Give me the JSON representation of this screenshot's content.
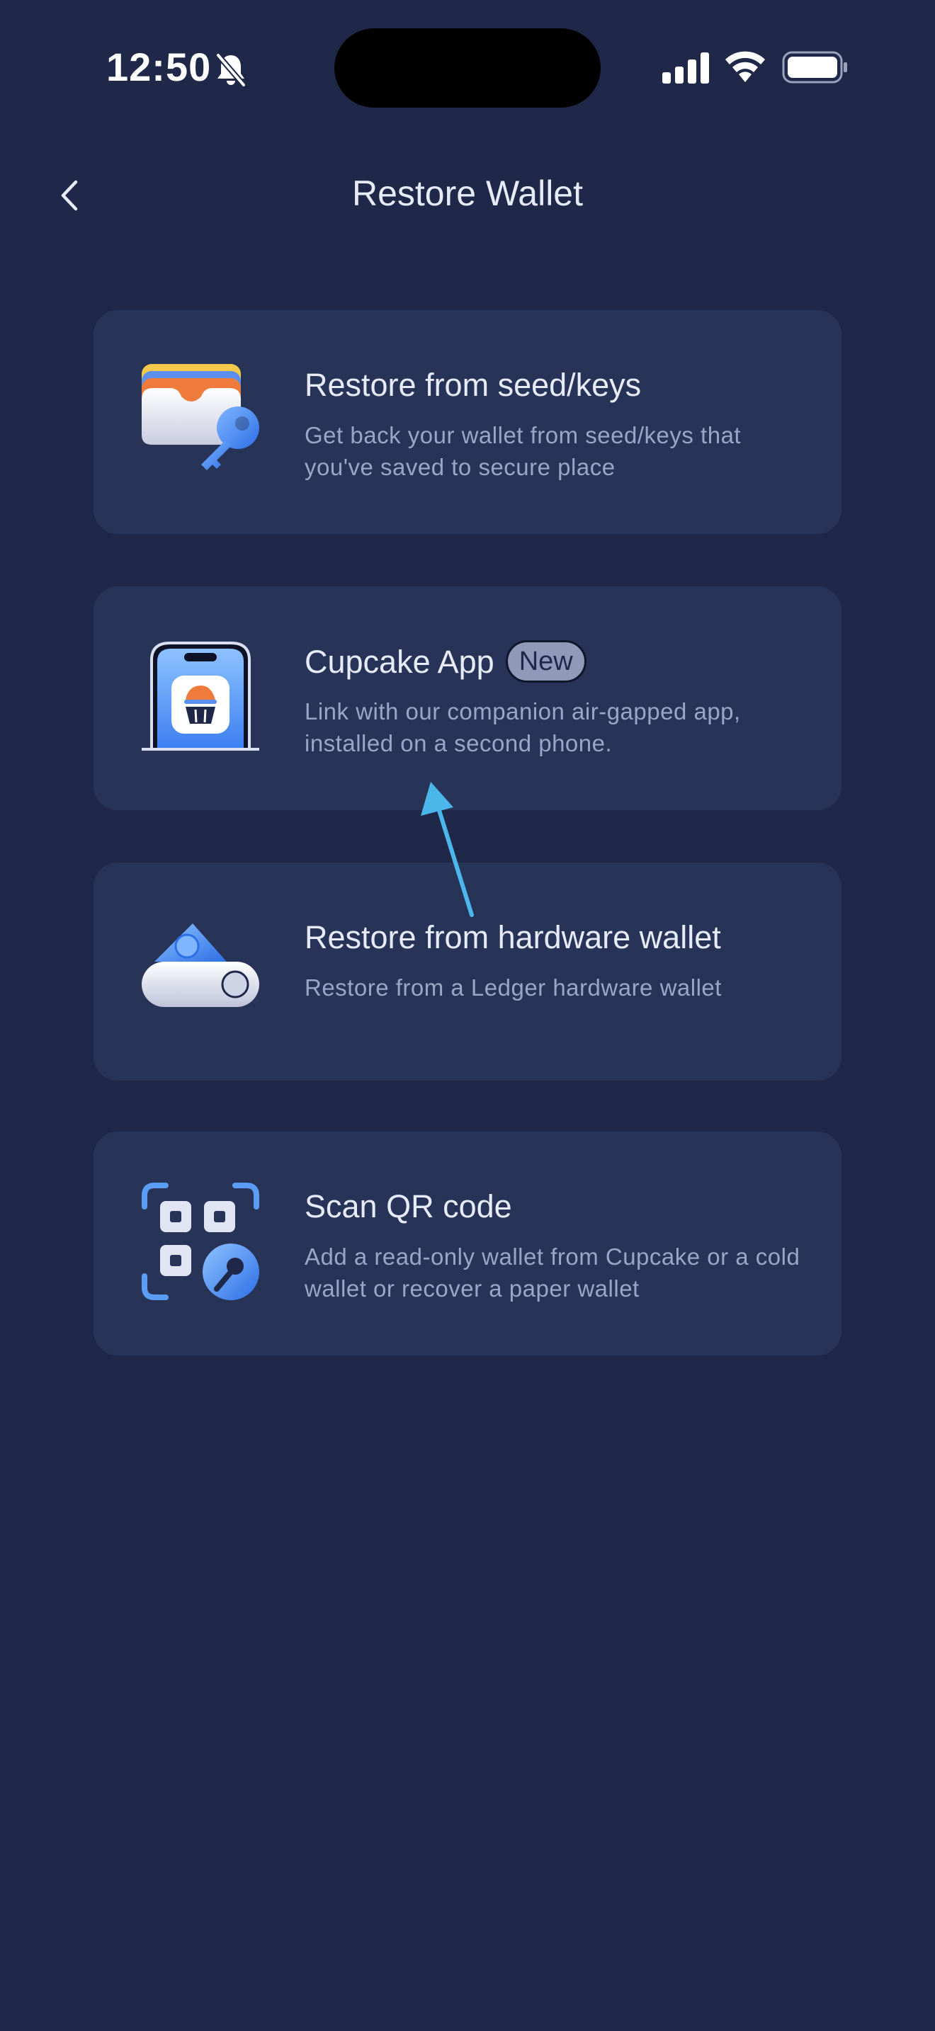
{
  "status_bar": {
    "time": "12:50",
    "icons": [
      "bell-slash-icon",
      "signal-icon",
      "wifi-icon",
      "battery-icon"
    ]
  },
  "header": {
    "title": "Restore Wallet",
    "back_icon": "chevron-left-icon"
  },
  "options": [
    {
      "title": "Restore from seed/keys",
      "description": "Get back your wallet from seed/keys that you've saved to secure place",
      "icon": "wallet-key-icon"
    },
    {
      "title": "Cupcake App",
      "badge": "New",
      "description": "Link with our companion air-gapped app, installed on a second phone.",
      "icon": "phone-cupcake-icon"
    },
    {
      "title": "Restore from hardware wallet",
      "description": "Restore from a Ledger hardware wallet",
      "icon": "hardware-wallet-icon"
    },
    {
      "title": "Scan QR code",
      "description": "Add a read-only wallet from Cupcake or a cold wallet or recover a paper wallet",
      "icon": "qr-key-icon"
    }
  ],
  "colors": {
    "background": "#1f2849",
    "card": "#283358",
    "title_text": "#e6ebf7",
    "description_text": "#9ba6c6",
    "badge_bg": "#8f9ab9",
    "annotation_arrow": "#4bb6ea"
  }
}
